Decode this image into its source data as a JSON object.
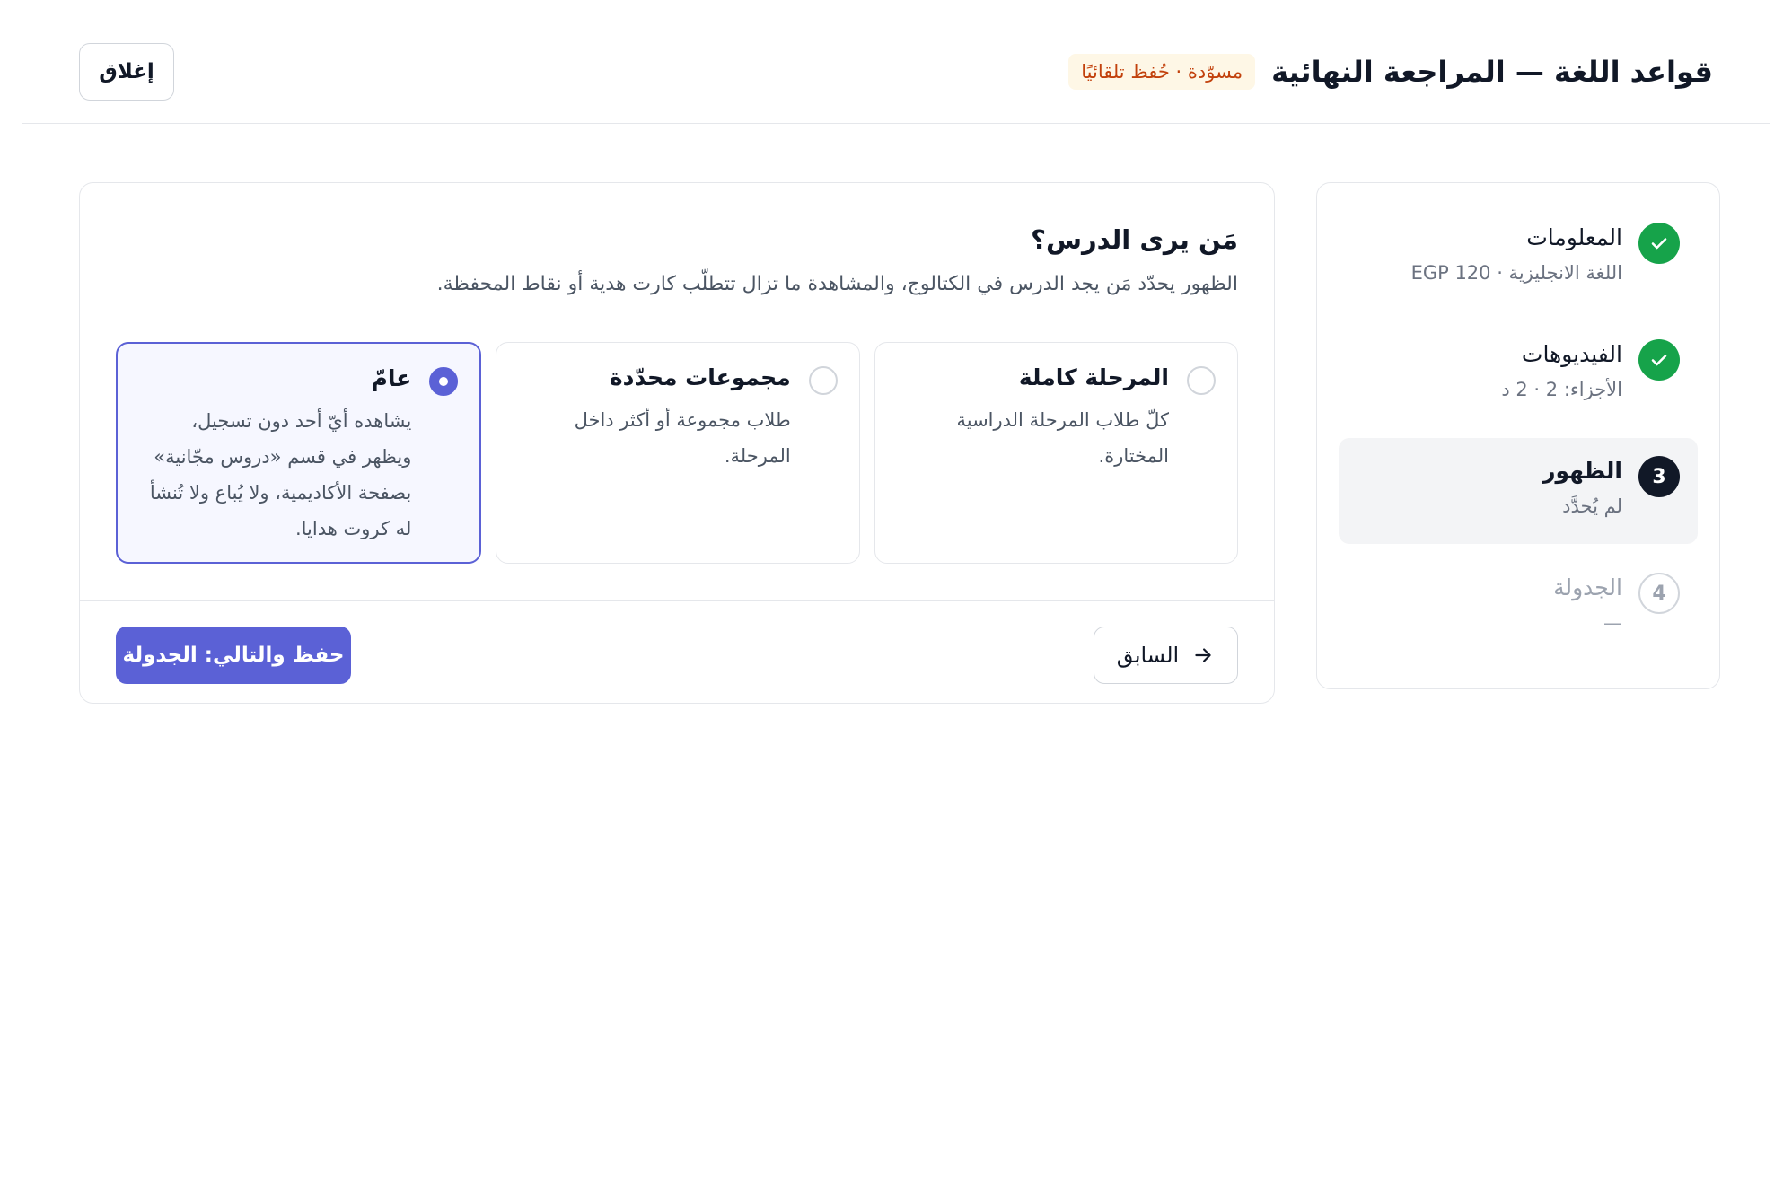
{
  "header": {
    "title": "قواعد اللغة — المراجعة النهائية",
    "draft_badge": "مسوّدة · حُفظ تلقائيًا",
    "close_label": "إغلاق"
  },
  "stepper": {
    "steps": [
      {
        "number": "1",
        "title": "المعلومات",
        "subtitle": "اللغة الانجليزية · EGP 120",
        "state": "done"
      },
      {
        "number": "2",
        "title": "الفيديوهات",
        "subtitle": "الأجزاء: 2 · 2 د",
        "state": "done"
      },
      {
        "number": "3",
        "title": "الظهور",
        "subtitle": "لم يُحدَّد",
        "state": "current"
      },
      {
        "number": "4",
        "title": "الجدولة",
        "subtitle": "—",
        "state": "pending"
      }
    ]
  },
  "visibility": {
    "title": "مَن يرى الدرس؟",
    "description": "الظهور يحدّد مَن يجد الدرس في الكتالوج، والمشاهدة ما تزال تتطلّب كارت هدية أو نقاط المحفظة.",
    "options": [
      {
        "title": "المرحلة كاملة",
        "description": "كلّ طلاب المرحلة الدراسية المختارة.",
        "selected": false
      },
      {
        "title": "مجموعات محدّدة",
        "description": "طلاب مجموعة أو أكثر داخل المرحلة.",
        "selected": false
      },
      {
        "title": "عامّ",
        "description": "يشاهده أيّ أحد دون تسجيل، ويظهر في قسم «دروس مجّانية» بصفحة الأكاديمية، ولا يُباع ولا تُنشأ له كروت هدايا.",
        "selected": true
      }
    ]
  },
  "footer": {
    "prev_label": "السابق",
    "next_label": "حفظ والتالي: الجدولة"
  },
  "colors": {
    "accent": "#5b61d6",
    "success": "#16a34a",
    "draft_text": "#c2410c",
    "draft_bg": "#fef7e6"
  },
  "icons": {
    "step_done": "check-icon",
    "prev": "arrow-right-icon"
  }
}
